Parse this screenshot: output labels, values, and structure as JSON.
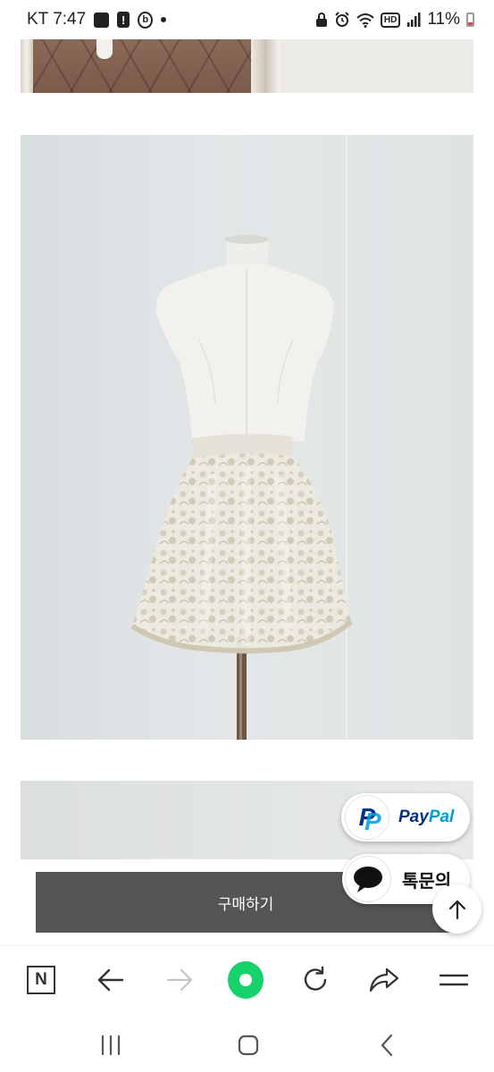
{
  "status_bar": {
    "carrier_time": "KT 7:47",
    "battery": "11%",
    "hd_label": "HD",
    "icons": [
      "photo-icon",
      "alert-icon",
      "b-app-icon",
      "dot-icon",
      "lock-icon",
      "alarm-icon",
      "wifi-icon",
      "hd-icon",
      "signal-icon",
      "battery-icon"
    ]
  },
  "product": {
    "photos": [
      "top-photo-partial",
      "main-photo-skirt-on-mannequin",
      "bottom-photo-partial"
    ]
  },
  "buy": {
    "label": "구매하기"
  },
  "paypal": {
    "logo_letter": "P",
    "text_part1": "Pay",
    "text_part2": "Pal",
    "brand_dark": "#003087",
    "brand_light": "#009cde"
  },
  "chat": {
    "label": "톡문의"
  },
  "scroll_top": {
    "icon": "arrow-up-icon"
  },
  "browser_toolbar": {
    "naver_label": "N",
    "items": [
      "naver-home-icon",
      "back-arrow-icon",
      "forward-arrow-icon",
      "green-action-button",
      "refresh-icon",
      "share-icon",
      "menu-icon"
    ],
    "accent": "#15d36a"
  },
  "android_nav": {
    "items": [
      "recent-apps-icon",
      "home-icon",
      "back-icon"
    ]
  }
}
